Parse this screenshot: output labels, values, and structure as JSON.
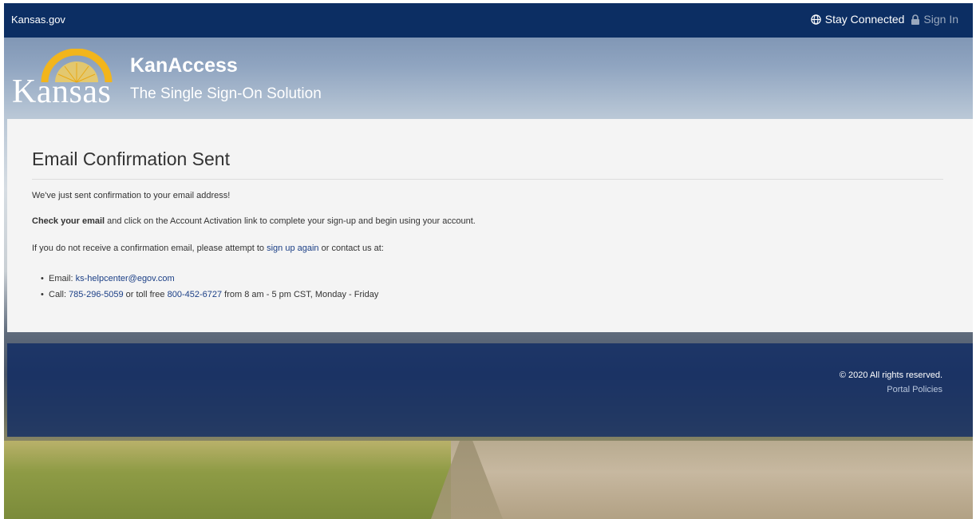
{
  "topbar": {
    "brand_link": "Kansas.gov",
    "stay_connected": "Stay Connected",
    "sign_in": "Sign In"
  },
  "header": {
    "logo_text": "Kansas",
    "app_title": "KanAccess",
    "app_subtitle": "The Single Sign-On Solution"
  },
  "card": {
    "title": "Email Confirmation Sent",
    "line1": "We've just sent confirmation to your email address!",
    "line2_bold": "Check your email",
    "line2_rest": " and click on the Account Activation link to complete your sign-up and begin using your account.",
    "line3_pre": "If you do not receive a confirmation email, please attempt to ",
    "line3_link": "sign up again",
    "line3_post": " or contact us at:",
    "bullet": "•",
    "email_label": "Email: ",
    "email": "ks-helpcenter@egov.com",
    "call_label": "Call: ",
    "phone": "785-296-5059",
    "toll_free_text": " or toll free ",
    "toll_free": "800-452-6727",
    "hours": " from 8 am - 5 pm CST, Monday - Friday"
  },
  "footer": {
    "copyright": "© 2020 All rights reserved.",
    "policies": "Portal Policies"
  },
  "colors": {
    "topbar": "#0c2e63",
    "link": "#1b3f86",
    "card_bg": "#f4f4f4",
    "logo_arc": "#f2b51c"
  },
  "icons": [
    "globe-icon",
    "lock-icon",
    "kansas-logo-arc-icon"
  ]
}
